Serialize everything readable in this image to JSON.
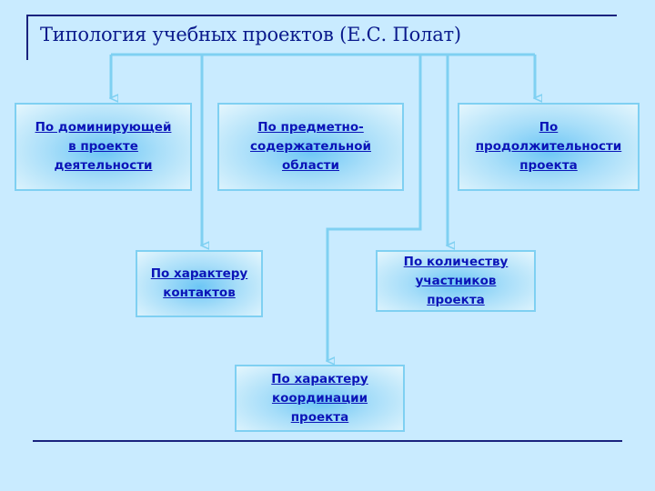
{
  "title": "Типология  учебных проектов (Е.С. Полат)",
  "colors": {
    "background": "#c9ebff",
    "title_text": "#0a1a8c",
    "frame_rule": "#1a237e",
    "connector": "#7fd0f2",
    "box_text": "#0b14b8"
  },
  "nodes": [
    {
      "id": "dominant-activity",
      "label": "По доминирующей\nв проекте\nдеятельности"
    },
    {
      "id": "subject-area",
      "label": "По предметно-\nсодержательной\nобласти"
    },
    {
      "id": "duration",
      "label": "По\nпродолжительности\nпроекта"
    },
    {
      "id": "contacts",
      "label": "По характеру\n контактов"
    },
    {
      "id": "participants",
      "label": "По количеству\nучастников\nпроекта"
    },
    {
      "id": "coordination",
      "label": "По характеру\nкоординации\nпроекта"
    }
  ]
}
